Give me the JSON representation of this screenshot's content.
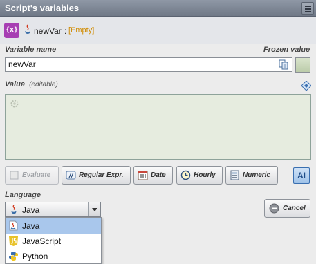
{
  "window": {
    "title": "Script's variables"
  },
  "variable": {
    "name": "newVar",
    "separator": ":",
    "value": "[Empty]"
  },
  "labels": {
    "variable_name": "Variable name",
    "frozen_value": "Frozen value",
    "value": "Value",
    "value_hint": "(editable)",
    "language": "Language"
  },
  "inputs": {
    "variable_name_value": "newVar"
  },
  "buttons": {
    "evaluate": "Evaluate",
    "regular_expr": "Regular Expr.",
    "date": "Date",
    "hourly": "Hourly",
    "numeric": "Numeric",
    "ai": "AI",
    "cancel": "Cancel"
  },
  "language": {
    "selected": "Java",
    "options": [
      "Java",
      "JavaScript",
      "Python"
    ]
  },
  "colors": {
    "variable_icon": "#a73fb3",
    "empty_value": "#d08b00",
    "selected_option": "#a9c7ec"
  }
}
